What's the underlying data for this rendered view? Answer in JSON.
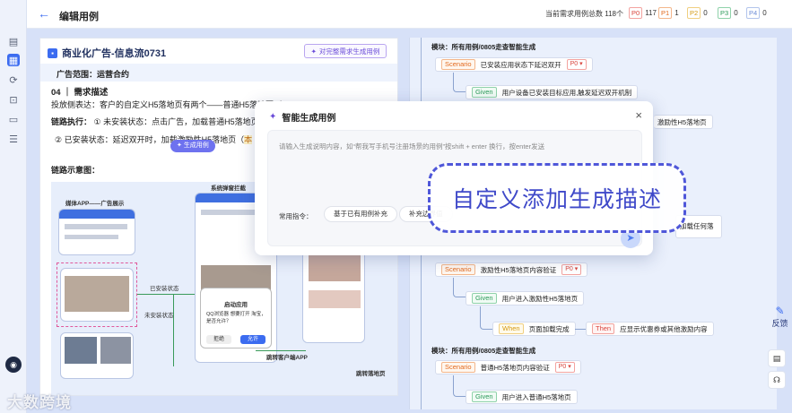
{
  "header": {
    "title": "编辑用例",
    "count_text": "当前需求用例总数 118个",
    "priorities": [
      {
        "tag": "P0",
        "count": "117",
        "color": "#d9453d"
      },
      {
        "tag": "P1",
        "count": "1",
        "color": "#e2691d"
      },
      {
        "tag": "P2",
        "count": "0",
        "color": "#d49a12"
      },
      {
        "tag": "P3",
        "count": "0",
        "color": "#2c9a5a"
      },
      {
        "tag": "P4",
        "count": "0",
        "color": "#6b8cd6"
      }
    ]
  },
  "doc": {
    "title": "商业化广告-信息流0731",
    "gen_button": "对完整需求生成用例",
    "scope": "广告范围：运营合约",
    "section": "04 ｜ 需求描述",
    "line1": "投放侧表达：客户的自定义H5落地页有两个——普通H5落地页（",
    "line2_label": "链路执行：",
    "line2": "① 未安装状态：点击广告，加载普通H5落地页",
    "line3": "② 已安装状态：延迟双开时，加载激励性H5落地页（",
    "line3_hl": "本",
    "float_button": "生成用例",
    "diagram_label": "链路示意图：",
    "diagram": {
      "media_app": "媒体APP——广告展示",
      "system_popup": "系统弹窗拦截",
      "installed": "已安装状态",
      "not_installed": "未安装状态",
      "popup_title": "启动应用",
      "popup_desc": "QQ浏览器 想要打开 淘宝，是否允许？",
      "popup_reject": "拒绝",
      "popup_allow": "允许",
      "jump_app": "跳转客户端APP",
      "jump_landing": "跳转落地页"
    }
  },
  "mindmap": {
    "modules": [
      {
        "label": "模块：所有用例/0805走查智能生成"
      },
      {
        "label": "模块：所有用例/0805走查智能生成"
      }
    ],
    "nodes": [
      {
        "kw": "Scenario",
        "text": "已安装应用状态下延迟双开",
        "prio": "P0"
      },
      {
        "kw": "Given",
        "text": "用户设备已安装目标应用,触发延迟双开机制"
      },
      {
        "kw": "",
        "text": "激励性H5落地页"
      },
      {
        "kw": "",
        "text": "加载任何落"
      },
      {
        "kw": "Scenario",
        "text": "激励性H5落地页内容验证",
        "prio": "P0"
      },
      {
        "kw": "Given",
        "text": "用户进入激励性H5落地页"
      },
      {
        "kw": "When",
        "text": "页面加载完成"
      },
      {
        "kw": "Then",
        "text": "应显示优惠券或其他激励内容"
      },
      {
        "kw": "Scenario",
        "text": "普通H5落地页内容验证",
        "prio": "P0"
      },
      {
        "kw": "Given",
        "text": "用户进入普通H5落地页"
      }
    ]
  },
  "dialog": {
    "title": "智能生成用例",
    "close": "×",
    "placeholder": "请输入生成说明内容，如“帮我写手机号注册场景的用例”按shift + enter 换行，按enter发送",
    "commands_label": "常用指令：",
    "commands": [
      "基于已有用例补充",
      "补充边界值"
    ]
  },
  "callout": "自定义添加生成描述",
  "right_tools": {
    "feedback": "反馈"
  },
  "watermark": "大数跨境"
}
